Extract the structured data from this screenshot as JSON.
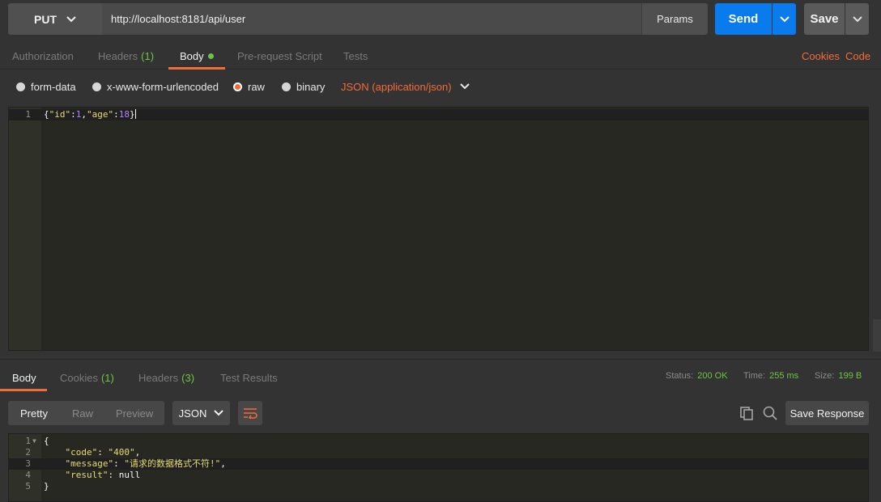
{
  "request": {
    "method": "PUT",
    "url": "http://localhost:8181/api/user",
    "params_label": "Params",
    "send_label": "Send",
    "save_label": "Save"
  },
  "request_tabs": {
    "authorization": "Authorization",
    "headers": "Headers",
    "headers_count": "(1)",
    "body": "Body",
    "prerequest": "Pre-request Script",
    "tests": "Tests",
    "cookies_link": "Cookies",
    "code_link": "Code"
  },
  "body_types": {
    "form_data": "form-data",
    "urlencoded": "x-www-form-urlencoded",
    "raw": "raw",
    "binary": "binary",
    "selected": "raw",
    "content_type": "JSON (application/json)"
  },
  "request_body": {
    "line_numbers": [
      "1"
    ],
    "tokens": [
      "{",
      "\"id\"",
      ":",
      "1",
      ",",
      "\"age\"",
      ":",
      "18",
      "}"
    ]
  },
  "response_tabs": {
    "body": "Body",
    "cookies": "Cookies",
    "cookies_count": "(1)",
    "headers": "Headers",
    "headers_count": "(3)",
    "test_results": "Test Results"
  },
  "response_meta": {
    "status_label": "Status:",
    "status_value": "200 OK",
    "time_label": "Time:",
    "time_value": "255 ms",
    "size_label": "Size:",
    "size_value": "199 B"
  },
  "response_toolbar": {
    "pretty": "Pretty",
    "raw": "Raw",
    "preview": "Preview",
    "format": "JSON",
    "save_response": "Save Response"
  },
  "response_body": {
    "line_numbers": [
      "1",
      "2",
      "3",
      "4",
      "5"
    ],
    "open_brace": "{",
    "close_brace": "}",
    "lines": [
      {
        "key": "\"code\"",
        "value": "\"400\"",
        "comma": ","
      },
      {
        "key": "\"message\"",
        "value": "\"请求的数据格式不符!\"",
        "comma": ","
      },
      {
        "key": "\"result\"",
        "value": "null",
        "comma": ""
      }
    ]
  },
  "colors": {
    "accent": "#f26b3a",
    "send_blue": "#097bed",
    "status_green": "#6cc644",
    "editor_bg": "#272822"
  }
}
